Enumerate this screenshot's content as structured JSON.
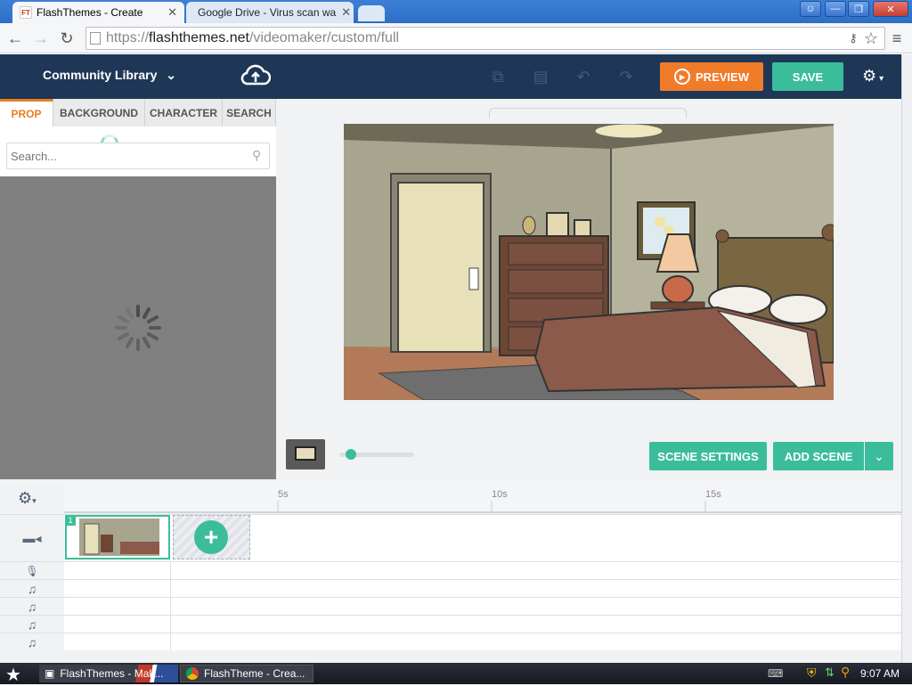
{
  "browser": {
    "tabs": [
      {
        "label": "FlashThemes - Create",
        "favicon": "FT"
      },
      {
        "label": "Google Drive - Virus scan wa",
        "favicon": "drive"
      }
    ],
    "url_scheme": "https://",
    "url_host": "flashthemes.net",
    "url_path": "/videomaker/custom/full"
  },
  "header": {
    "library_label": "Community Library",
    "preview_label": "PREVIEW",
    "save_label": "SAVE"
  },
  "left_panel": {
    "tabs": [
      "PROP",
      "BACKGROUND",
      "CHARACTER",
      "SEARCH"
    ],
    "active_tab": "PROP",
    "search_placeholder": "Search..."
  },
  "stage": {
    "scene_settings_label": "SCENE SETTINGS",
    "add_scene_label": "ADD SCENE",
    "zoom": 0.1
  },
  "timeline": {
    "ruler_labels": [
      "5s",
      "10s",
      "15s"
    ],
    "scene_number": "1",
    "tracks": [
      "video",
      "voice",
      "music",
      "music",
      "music",
      "music"
    ]
  },
  "taskbar": {
    "tasks": [
      "FlashThemes - Mak...",
      "FlashTheme - Crea..."
    ],
    "clock": "9:07 AM"
  },
  "colors": {
    "accent_green": "#3bbd9c",
    "accent_orange": "#f07c2a",
    "header_navy": "#1f3756"
  }
}
